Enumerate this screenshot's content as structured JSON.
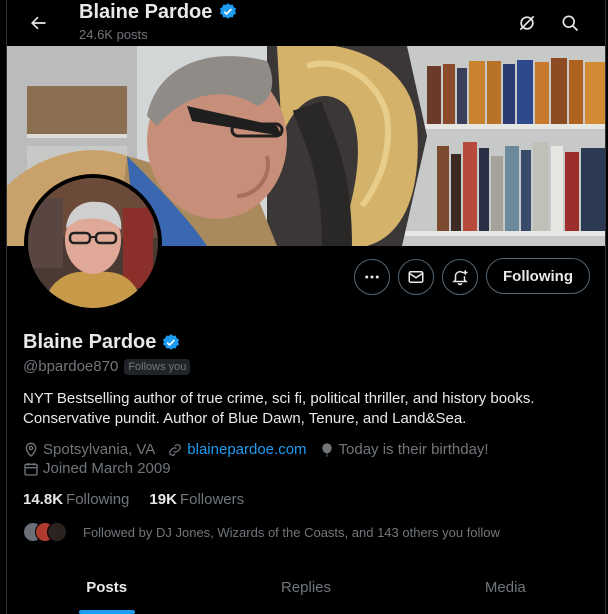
{
  "header": {
    "name": "Blaine Pardoe",
    "posts_count": "24.6K posts"
  },
  "profile": {
    "name": "Blaine Pardoe",
    "handle": "@bpardoe870",
    "follows_you": "Follows you",
    "bio": "NYT Bestselling author of true crime, sci fi, political thriller, and history books. Conservative pundit.  Author of Blue Dawn, Tenure, and Land&Sea.",
    "location": "Spotsylvania, VA",
    "website": "blainepardoe.com",
    "birthday": "Today is their birthday!",
    "joined": "Joined March 2009",
    "following_count": "14.8K",
    "following_label": "Following",
    "followers_count": "19K",
    "followers_label": "Followers",
    "followed_by": "Followed by DJ Jones, Wizards of the Coasts, and 143 others you follow"
  },
  "actions": {
    "follow_button": "Following"
  },
  "tabs": [
    {
      "label": "Posts",
      "active": true
    },
    {
      "label": "Replies",
      "active": false
    },
    {
      "label": "Media",
      "active": false
    }
  ],
  "colors": {
    "accent": "#1d9bf0",
    "background": "#000000",
    "muted": "#71767b",
    "text": "#e7e9ea",
    "border": "#536471"
  },
  "icons": [
    "back-arrow-icon",
    "grok-icon",
    "search-icon",
    "more-icon",
    "message-icon",
    "notification-bell-icon",
    "verified-badge-icon",
    "location-pin-icon",
    "link-icon",
    "balloon-icon",
    "calendar-icon"
  ]
}
